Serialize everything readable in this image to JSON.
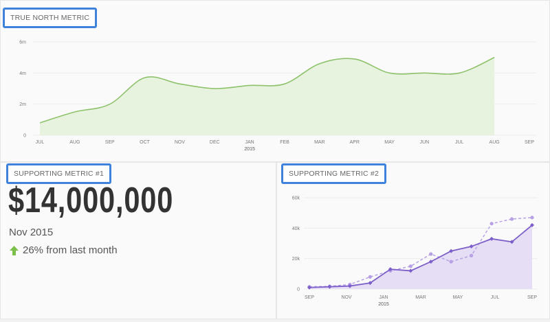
{
  "panels": {
    "top": {
      "tag": "TRUE NORTH METRIC"
    },
    "left": {
      "tag": "SUPPORTING METRIC #1",
      "value": "$14,000,000",
      "period": "Nov 2015",
      "change_text": "26% from last month",
      "change_icon": "arrow-up-icon",
      "change_color": "#7cc04b"
    },
    "right": {
      "tag": "SUPPORTING METRIC #2"
    }
  },
  "colors": {
    "tag_border": "#3e82dc",
    "green_line": "#8dc26b",
    "green_fill": "#e8f3df",
    "purple_line": "#7d5fc9",
    "purple_dash": "#b7a1e4",
    "purple_fill": "#e6def5"
  },
  "chart_data": [
    {
      "type": "area",
      "title": "TRUE NORTH METRIC",
      "categories": [
        "JUL",
        "AUG",
        "SEP",
        "OCT",
        "NOV",
        "DEC",
        "JAN",
        "FEB",
        "MAR",
        "APR",
        "MAY",
        "JUN",
        "JUL",
        "AUG",
        "SEP"
      ],
      "year_label": "2015",
      "series": [
        {
          "values": [
            0.8,
            1.5,
            2.0,
            3.7,
            3.3,
            3.0,
            3.2,
            3.3,
            4.6,
            4.9,
            4.0,
            4.0,
            4.0,
            5.0,
            null
          ]
        }
      ],
      "yticks": [
        "0",
        "2m",
        "4m",
        "6m"
      ],
      "ylim": [
        0,
        6
      ],
      "grid": true,
      "legend": "none"
    },
    {
      "type": "line",
      "title": "SUPPORTING METRIC #2",
      "categories": [
        "SEP",
        "NOV",
        "JAN",
        "MAR",
        "MAY",
        "JUL",
        "SEP"
      ],
      "year_label": "2015",
      "series": [
        {
          "style": "solid",
          "values": [
            1000,
            1500,
            2000,
            4000,
            13000,
            12000,
            18000,
            25000,
            28000,
            33000,
            31000,
            42000
          ]
        },
        {
          "style": "dashed",
          "values": [
            1500,
            1800,
            3000,
            8000,
            12000,
            15000,
            23000,
            18000,
            22000,
            43000,
            46000,
            47000
          ]
        }
      ],
      "yticks": [
        "0",
        "20k",
        "40k",
        "60k"
      ],
      "ylim": [
        0,
        60000
      ],
      "grid": true,
      "legend": "none"
    }
  ]
}
